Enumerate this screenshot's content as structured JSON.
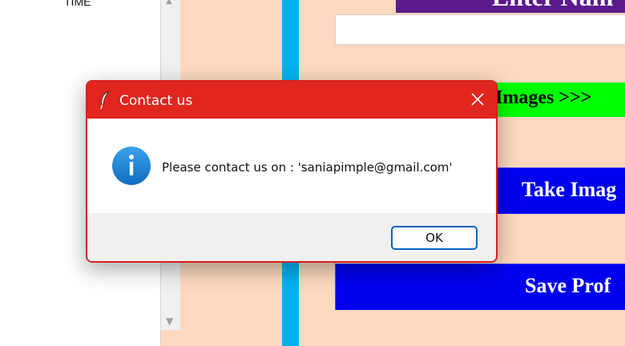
{
  "background_app": {
    "list_column_header": "TIME",
    "header_banner_text": "Enter Nam",
    "name_input_value": "",
    "images_button_label": "Images  >>>",
    "take_images_button_label": "Take Imag",
    "save_profile_button_label": "Save Prof",
    "colors": {
      "background": "#fdd9bf",
      "cyan_bar": "#00b3f4",
      "header_banner": "#5a1a8a",
      "images_button": "#00ff00",
      "blue_buttons": "#0000f0"
    }
  },
  "dialog": {
    "title": "Contact us",
    "message": "Please contact us on : 'saniapimple@gmail.com'",
    "ok_label": "OK",
    "icons": {
      "title_icon": "feather-icon",
      "close_icon": "close-icon",
      "message_icon": "info-icon"
    },
    "colors": {
      "titlebar": "#e0261e",
      "info_icon": "#1a84d8",
      "ok_border": "#0a64c2"
    }
  }
}
